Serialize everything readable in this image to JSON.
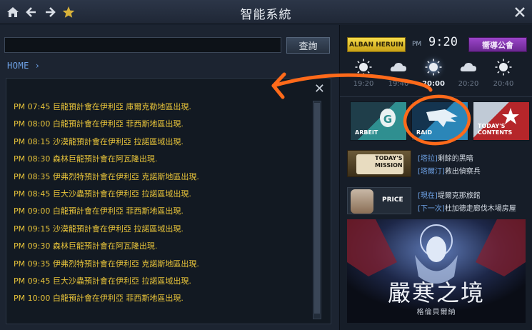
{
  "window": {
    "title": "智能系統"
  },
  "search": {
    "value": "",
    "placeholder": "",
    "button_label": "查詢"
  },
  "breadcrumb": {
    "label": "HOME"
  },
  "log": [
    {
      "time": "PM 07:45",
      "text": "巨龍預計會在伊利亞 庫爾克勒地區出現."
    },
    {
      "time": "PM 08:00",
      "text": "白龍預計會在伊利亞 菲西斯地區出現."
    },
    {
      "time": "PM 08:15",
      "text": "沙漠龍預計會在伊利亞 拉諾區域出現."
    },
    {
      "time": "PM 08:30",
      "text": "森林巨龍預計會在阿瓦隆出現."
    },
    {
      "time": "PM 08:35",
      "text": "伊弗烈特預計會在伊利亞 克諾斯地區出現."
    },
    {
      "time": "PM 08:45",
      "text": "巨大沙蟲預計會在伊利亞 拉諾區域出現."
    },
    {
      "time": "PM 09:00",
      "text": "白龍預計會在伊利亞 菲西斯地區出現."
    },
    {
      "time": "PM 09:15",
      "text": "沙漠龍預計會在伊利亞 拉諾區域出現."
    },
    {
      "time": "PM 09:30",
      "text": "森林巨龍預計會在阿瓦隆出現."
    },
    {
      "time": "PM 09:35",
      "text": "伊弗烈特預計會在伊利亞 克諾斯地區出現."
    },
    {
      "time": "PM 09:45",
      "text": "巨大沙蟲預計會在伊利亞 拉諾區域出現."
    },
    {
      "time": "PM 10:00",
      "text": "白龍預計會在伊利亞 菲西斯地區出現."
    }
  ],
  "clock": {
    "server_button": "ALBAN HERUIN",
    "ampm": "PM",
    "time": "9:20",
    "guide_button": "嚮導公會"
  },
  "weather": [
    {
      "icon": "sun-icon",
      "time": "19:20",
      "current": false
    },
    {
      "icon": "cloud-icon",
      "time": "19:40",
      "current": false
    },
    {
      "icon": "sun-icon",
      "time": "20:00",
      "current": true
    },
    {
      "icon": "cloud-icon",
      "time": "20:20",
      "current": false
    },
    {
      "icon": "sun-icon",
      "time": "20:40",
      "current": false
    }
  ],
  "tiles": [
    {
      "label": "ARBEIT",
      "letter": "G",
      "color": "#2f8f90"
    },
    {
      "label": "RAID",
      "color": "#2b86b8"
    },
    {
      "label": "TODAY'S CONTENTS",
      "color": "#b5262a"
    }
  ],
  "mission": {
    "icon_label_1": "TODAY'S",
    "icon_label_2": "MISSION",
    "line1_tag": "[塔拉]",
    "line1_text": "剩餘的黑暗",
    "line2_tag": "[塔爾汀]",
    "line2_text": "救出偵察兵"
  },
  "price": {
    "icon_label": "PRICE",
    "line1_tag": "[現在]",
    "line1_text": "堤爾克那旅館",
    "line2_tag": "[下一次]",
    "line2_text": "杜加德走廊伐木場房屋"
  },
  "banner": {
    "title": "嚴寒之境",
    "subtitle": "格倫貝爾納"
  },
  "colors": {
    "accent_yellow": "#e8c43a",
    "link_blue": "#6ea2e6",
    "annotation_orange": "#ff6a1a"
  }
}
